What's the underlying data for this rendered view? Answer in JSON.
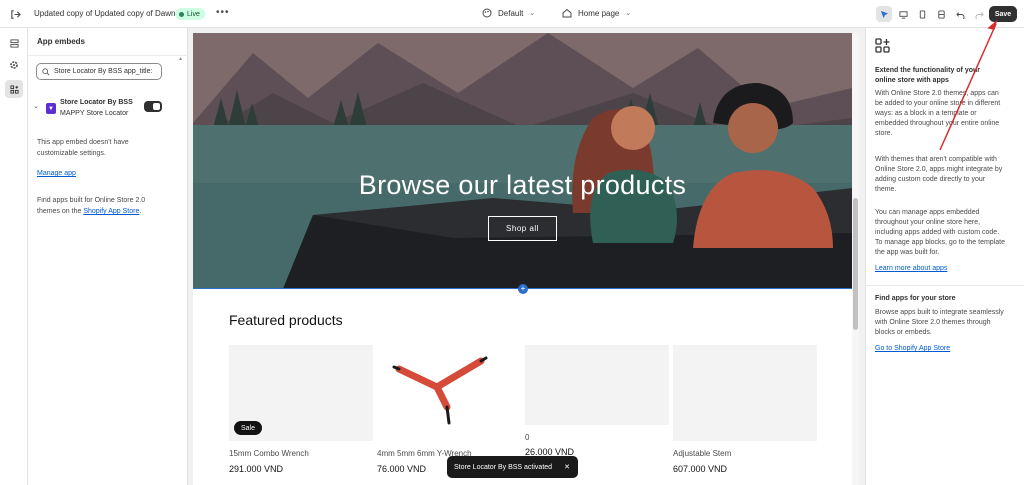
{
  "topbar": {
    "store_title": "Updated copy of Updated copy of Dawn",
    "status": "Live",
    "more": "•••",
    "theme_label": "Default",
    "page_label": "Home page",
    "save_label": "Save"
  },
  "left_panel": {
    "title": "App embeds",
    "search_value": "Store Locator By BSS app_title:",
    "embed": {
      "name": "Store Locator By BSS",
      "subtitle": "MAPPY Store Locator",
      "enabled": true
    },
    "no_settings_text": "This app embed doesn't have customizable settings.",
    "manage_link": "Manage app",
    "find_text_prefix": "Find apps built for Online Store 2.0 themes on the ",
    "find_link": "Shopify App Store",
    "find_text_suffix": "."
  },
  "canvas": {
    "hero": {
      "title": "Browse our latest products",
      "button": "Shop all"
    },
    "featured_title": "Featured products",
    "products": [
      {
        "name": "15mm Combo Wrench",
        "price": "291.000 VND",
        "badge": "Sale"
      },
      {
        "name": "4mm 5mm 6mm Y-Wrench",
        "price": "76.000 VND",
        "badge": ""
      },
      {
        "name": "0",
        "price": "26.000 VND",
        "badge": ""
      },
      {
        "name": "Adjustable Stem",
        "price": "607.000 VND",
        "badge": ""
      }
    ]
  },
  "toast": {
    "message": "Store Locator By BSS activated",
    "close": "✕"
  },
  "right_panel": {
    "heading": "Extend the functionality of your online store with apps",
    "p1": "With Online Store 2.0 themes, apps can be added to your online store in different ways: as a block in a template or embedded throughout your entire online store.",
    "p2": "With themes that aren't compatible with Online Store 2.0, apps might integrate by adding custom code directly to your theme.",
    "p3": "You can manage apps embedded throughout your online store here, including apps added with custom code. To manage app blocks, go to the template the app was built for.",
    "learn_link": "Learn more about apps",
    "find_heading": "Find apps for your store",
    "find_text": "Browse apps built to integrate seamlessly with Online Store 2.0 themes through blocks or embeds.",
    "store_link": "Go to Shopify App Store"
  },
  "colors": {
    "live_bg": "#cdfee1",
    "save_bg": "#303030",
    "link": "#005bd3",
    "selection": "#2c6ecb",
    "annotation_arrow": "#d62c2c"
  }
}
